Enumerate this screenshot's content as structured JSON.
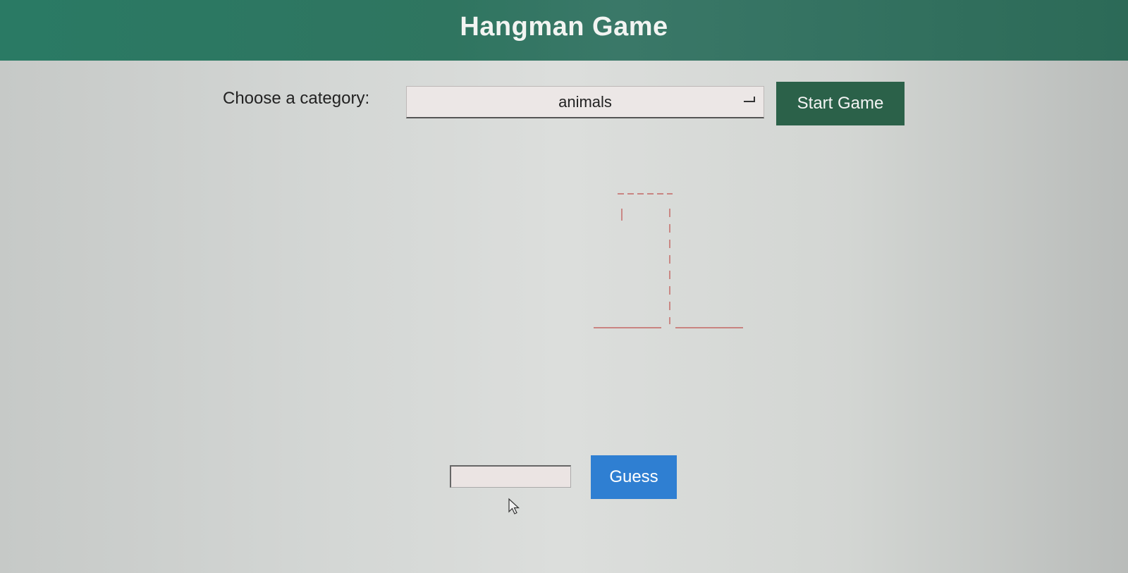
{
  "header": {
    "title": "Hangman Game"
  },
  "controls": {
    "category_label": "Choose a category:",
    "selected_category": "animals",
    "start_button_label": "Start Game"
  },
  "guess": {
    "input_value": "",
    "button_label": "Guess"
  },
  "colors": {
    "header": "#2f7560",
    "start_button": "#2b6149",
    "guess_button": "#2f7fd2",
    "gallows": "#c0504d"
  }
}
